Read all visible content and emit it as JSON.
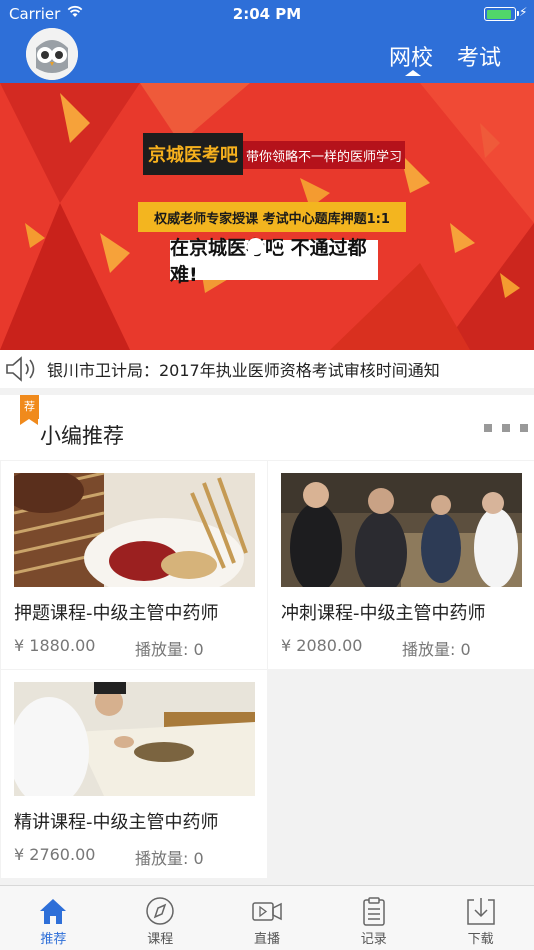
{
  "status_bar": {
    "carrier": "Carrier",
    "time": "2:04 PM"
  },
  "nav": {
    "tabs": [
      {
        "label": "网校",
        "active": true
      },
      {
        "label": "考试",
        "active": false
      }
    ]
  },
  "banner": {
    "title_main": "京城医考吧",
    "title_sub": "带你领略不一样的医师学习",
    "line2": "权威老师专家授课  考试中心题库押题1:1",
    "line3": "在京城医考吧 不通过都难!",
    "slides": 2,
    "active_slide": 0
  },
  "notice": {
    "text": "银川市卫计局：2017年执业医师资格考试审核时间通知"
  },
  "section": {
    "tag": "荐",
    "title": "小编推荐"
  },
  "courses": [
    {
      "name": "押题课程-中级主管中药师",
      "price": "¥ 1880.00",
      "plays": "播放量: 0"
    },
    {
      "name": "冲刺课程-中级主管中药师",
      "price": "¥ 2080.00",
      "plays": "播放量: 0"
    },
    {
      "name": "精讲课程-中级主管中药师",
      "price": "¥ 2760.00",
      "plays": "播放量: 0"
    }
  ],
  "tabbar": [
    {
      "label": "推荐",
      "icon": "home-icon",
      "active": true
    },
    {
      "label": "课程",
      "icon": "compass-icon",
      "active": false
    },
    {
      "label": "直播",
      "icon": "video-camera-icon",
      "active": false
    },
    {
      "label": "记录",
      "icon": "clipboard-icon",
      "active": false
    },
    {
      "label": "下载",
      "icon": "download-icon",
      "active": false
    }
  ],
  "colors": {
    "brand_blue": "#2e6fd8",
    "banner_red": "#e8392c",
    "tag_orange": "#f08a1c"
  }
}
